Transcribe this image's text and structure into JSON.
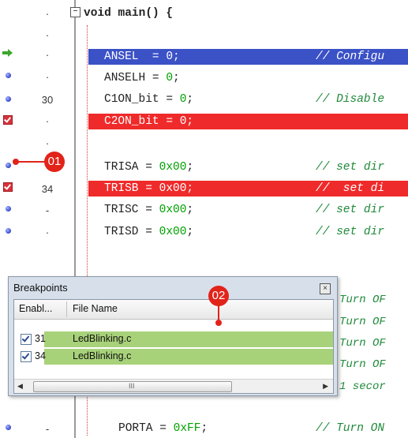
{
  "editor": {
    "lines": [
      {
        "num": "·",
        "code": "void main() {"
      },
      {
        "num": "·",
        "code": ""
      },
      {
        "num": "·",
        "code": "ANSEL  = 0;",
        "comment": "// Configu"
      },
      {
        "num": "·",
        "code": "ANSELH = 0;"
      },
      {
        "num": "30",
        "code": "C1ON_bit = 0;",
        "comment": "// Disable"
      },
      {
        "num": "·",
        "code": "C2ON_bit = 0;"
      },
      {
        "num": "·",
        "code": ""
      },
      {
        "num": "·",
        "code": "TRISA = 0x00;",
        "comment": "// set dir"
      },
      {
        "num": "34",
        "code": "TRISB = 0x00;",
        "comment": "//  set di"
      },
      {
        "num": "-",
        "code": "TRISC = 0x00;",
        "comment": "// set dir"
      },
      {
        "num": "·",
        "code": "TRISD = 0x00;",
        "comment": "// set dir"
      },
      {
        "num": "-",
        "code": "PORTA = 0xFF;",
        "comment": "// Turn ON"
      }
    ],
    "turn_comments": [
      "Turn OF",
      "Turn OF",
      "Turn OF",
      "Turn OF",
      "1 secor"
    ]
  },
  "callouts": {
    "first": "01",
    "second": "02"
  },
  "breakpoints_panel": {
    "title": "Breakpoints",
    "close_glyph": "×",
    "columns": {
      "enabled": "Enabl...",
      "file": "File Name"
    },
    "rows": [
      {
        "line": "31",
        "file": "LedBlinking.c",
        "enabled": true
      },
      {
        "line": "34",
        "file": "LedBlinking.c",
        "enabled": true
      }
    ],
    "scroll_grip": "III"
  },
  "colors": {
    "current_line": "#3b51c6",
    "breakpoint_line": "#ef2a2a",
    "callout": "#e2231a",
    "row_highlight": "#a8d27a",
    "comment": "#1f8a3a"
  }
}
